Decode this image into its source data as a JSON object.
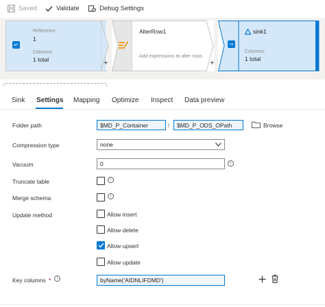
{
  "toolbar": {
    "saved_label": "Saved",
    "validate_label": "Validate",
    "debug_settings_label": "Debug Settings"
  },
  "flow": {
    "source": {
      "reference_label": "Reference:",
      "reference_value": "1",
      "columns_label": "Columns:",
      "columns_value": "1 total"
    },
    "alter_row": {
      "title": "AlterRow1",
      "hint": "Add expressions to alter rows"
    },
    "sink": {
      "title": "sink1",
      "columns_label": "Columns:",
      "columns_value": "1 total"
    },
    "plus_symbol": "+"
  },
  "tabs": [
    {
      "label": "Sink"
    },
    {
      "label": "Settings"
    },
    {
      "label": "Mapping"
    },
    {
      "label": "Optimize"
    },
    {
      "label": "Inspect"
    },
    {
      "label": "Data preview"
    }
  ],
  "active_tab": "Settings",
  "settings": {
    "folder_path": {
      "label": "Folder path",
      "container": "$MD_P_Container",
      "separator": "/",
      "path": "$MD_P_ODS_OPath",
      "browse_label": "Browse"
    },
    "compression_type": {
      "label": "Compression type",
      "value": "none"
    },
    "vacuum": {
      "label": "Vacuum",
      "value": "0"
    },
    "truncate_table": {
      "label": "Truncate table",
      "checked": false
    },
    "merge_schema": {
      "label": "Merge schema",
      "checked": false
    },
    "update_method": {
      "label": "Update method",
      "options": [
        {
          "label": "Allow insert",
          "checked": false
        },
        {
          "label": "Allow delete",
          "checked": false
        },
        {
          "label": "Allow upsert",
          "checked": true
        },
        {
          "label": "Allow update",
          "checked": false
        }
      ]
    },
    "key_columns": {
      "label": "Key columns",
      "required_mark": "*",
      "value": "byName('AIDNLIFDMD')"
    }
  },
  "colors": {
    "accent": "#0078d4",
    "node_border": "#c8c6c4",
    "active_node_fill": "#d5e8f9"
  }
}
